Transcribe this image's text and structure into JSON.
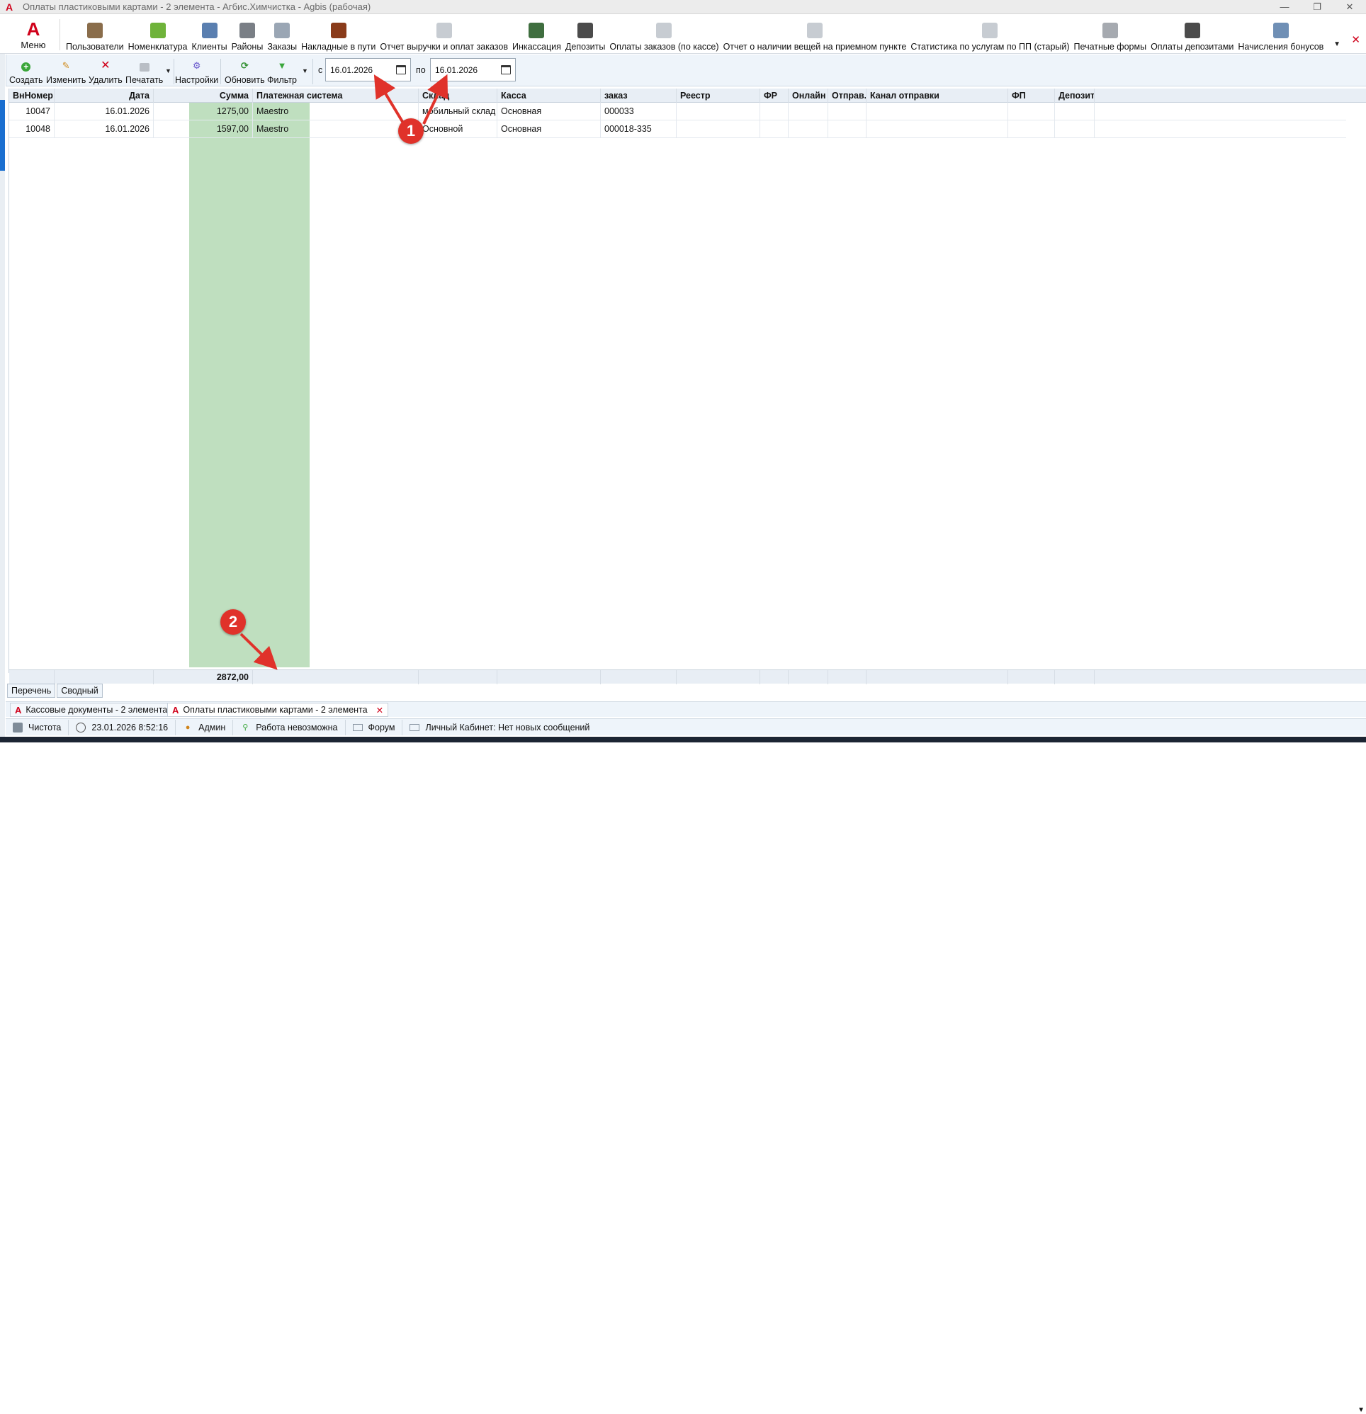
{
  "window": {
    "title": "Оплаты пластиковыми картами - 2 элемента - Агбис.Химчистка - Agbis (рабочая)",
    "controls": [
      "—",
      "❐",
      "✕"
    ]
  },
  "ribbon": {
    "menu_label": "Меню",
    "items": [
      {
        "label": "Пользователи",
        "icon": "users-icon",
        "color": "#8a6d4b"
      },
      {
        "label": "Номенклатура",
        "icon": "basket-icon",
        "color": "#6fb33a"
      },
      {
        "label": "Клиенты",
        "icon": "client-icon",
        "color": "#5a7fb0"
      },
      {
        "label": "Районы",
        "icon": "districts-icon",
        "color": "#7a7f86"
      },
      {
        "label": "Заказы",
        "icon": "orders-icon",
        "color": "#9aa6b4"
      },
      {
        "label": "Накладные в пути",
        "icon": "truck-icon",
        "color": "#8a3b1a"
      },
      {
        "label": "Отчет выручки и оплат заказов",
        "icon": "report-icon",
        "color": "#c7ccd2"
      },
      {
        "label": "Инкассация",
        "icon": "money-icon",
        "color": "#3f6e3f"
      },
      {
        "label": "Депозиты",
        "icon": "deposit-icon",
        "color": "#4b4b4b"
      },
      {
        "label": "Оплаты заказов (по кассе)",
        "icon": "report-icon",
        "color": "#c7ccd2"
      },
      {
        "label": "Отчет о наличии вещей на приемном пункте",
        "icon": "report-icon",
        "color": "#c7ccd2"
      },
      {
        "label": "Статистика по услугам по ПП (старый)",
        "icon": "report-icon",
        "color": "#c7ccd2"
      },
      {
        "label": "Печатные формы",
        "icon": "printer-icon",
        "color": "#a6aab0"
      },
      {
        "label": "Оплаты депозитами",
        "icon": "deposit-pay-icon",
        "color": "#4b4b4b"
      },
      {
        "label": "Начисления бонусов",
        "icon": "gift-icon",
        "color": "#6f8fb5"
      }
    ]
  },
  "toolbar": {
    "create": "Создать",
    "edit": "Изменить",
    "delete": "Удалить",
    "print": "Печатать",
    "settings": "Настройки",
    "refresh": "Обновить",
    "filter": "Фильтр",
    "from_label": "с",
    "to_label": "по",
    "date_from": "16.01.2026",
    "date_to": "16.01.2026"
  },
  "grid": {
    "columns": [
      "ВнНомер",
      "Дата",
      "Сумма",
      "Платежная система",
      "Склад",
      "Касса",
      "заказ",
      "Реестр",
      "ФР",
      "Онлайн",
      "Отправ...",
      "Канал отправки",
      "ФП",
      "Депозит"
    ],
    "rows": [
      [
        "10047",
        "16.01.2026",
        "1275,00",
        "Maestro",
        "мобильный склад",
        "Основная",
        "000033",
        "",
        "",
        "",
        "",
        "",
        "",
        ""
      ],
      [
        "10048",
        "16.01.2026",
        "1597,00",
        "Maestro",
        "Основной",
        "Основная",
        "000018-335",
        "",
        "",
        "",
        "",
        "",
        "",
        ""
      ]
    ],
    "total_sum": "2872,00",
    "sum_column_color": "#bfdfbf"
  },
  "annotations": {
    "badge1": "1",
    "badge2": "2",
    "color": "#e0322a"
  },
  "view_tabs": [
    "Перечень",
    "Сводный"
  ],
  "doc_tabs": [
    {
      "label": "Кассовые документы - 2 элемента"
    },
    {
      "label": "Оплаты пластиковыми картами - 2 элемента"
    }
  ],
  "status": {
    "db": "Чистота",
    "datetime": "23.01.2026 8:52:16",
    "user": "Админ",
    "work": "Работа невозможна",
    "forum": "Форум",
    "cabinet": "Личный Кабинет: Нет новых сообщений"
  }
}
